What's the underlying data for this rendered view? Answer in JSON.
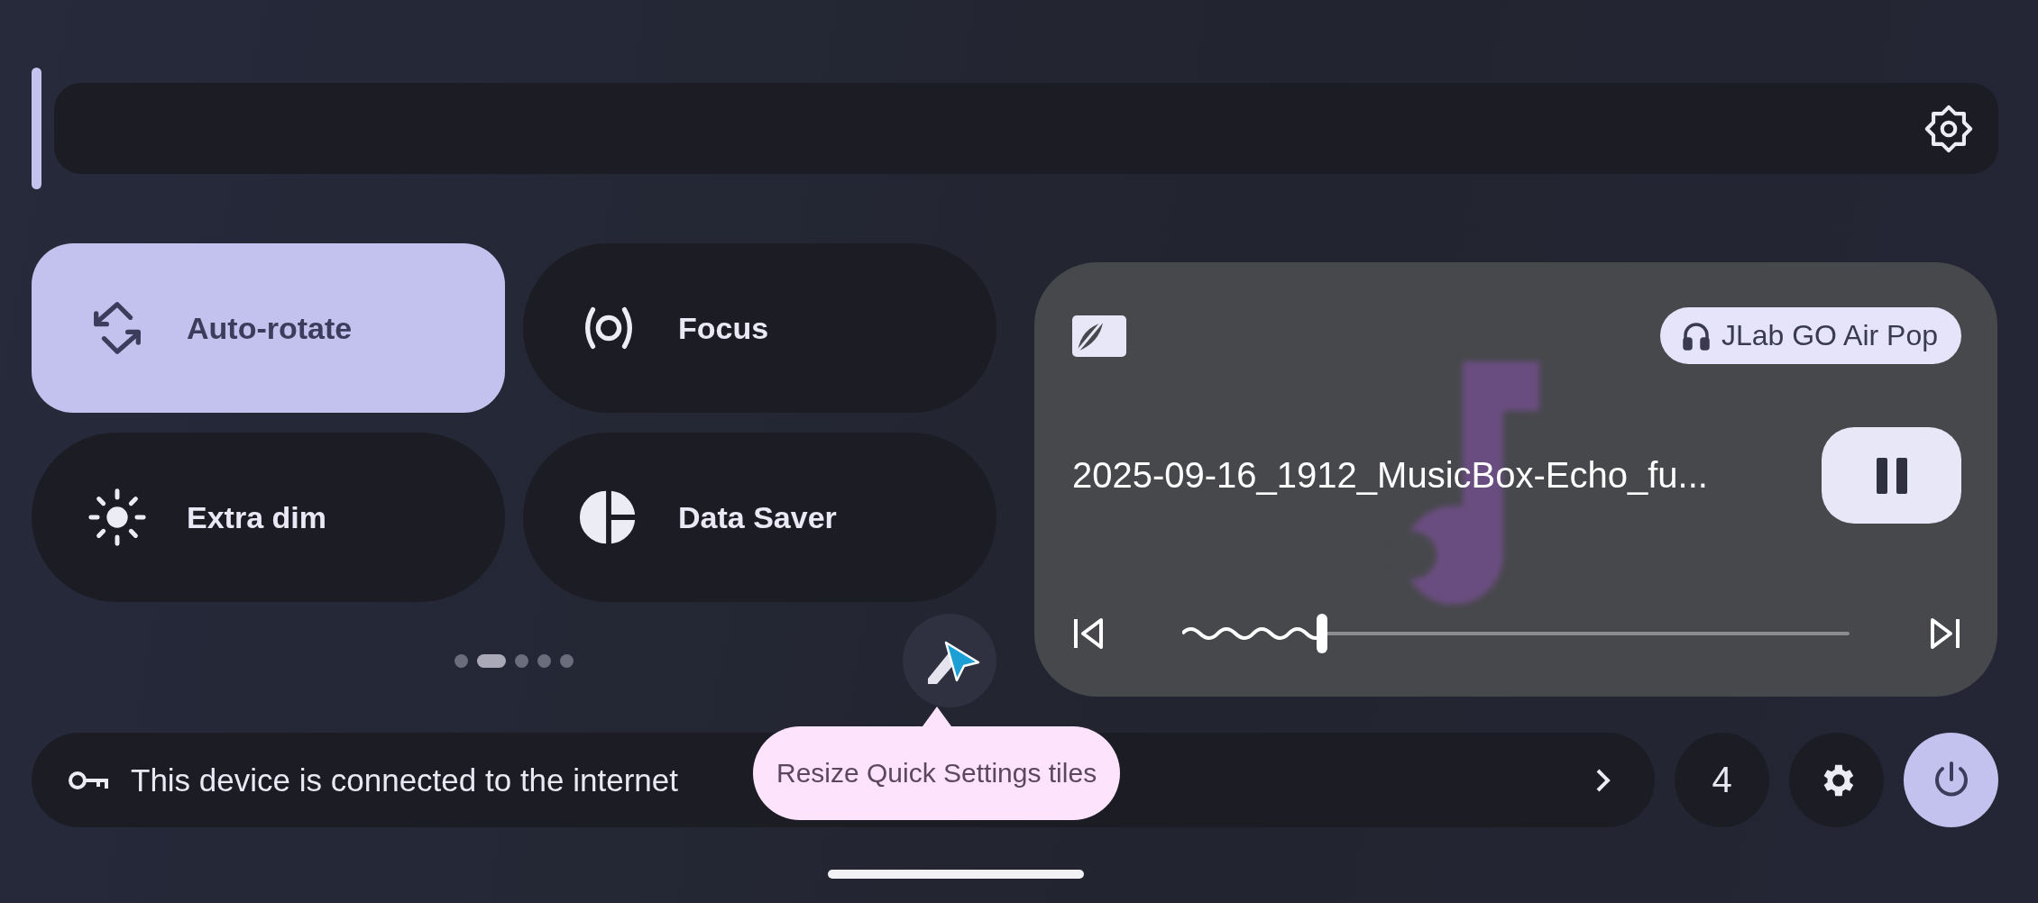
{
  "brightness": {
    "level": 0
  },
  "tiles": [
    {
      "label": "Auto-rotate",
      "kind": "rotate",
      "on": true
    },
    {
      "label": "Focus",
      "kind": "focus",
      "on": false
    },
    {
      "label": "Extra dim",
      "kind": "dim",
      "on": false
    },
    {
      "label": "Data Saver",
      "kind": "saver",
      "on": false
    }
  ],
  "pages": [
    {
      "selected": false
    },
    {
      "selected": true
    },
    {
      "selected": false
    },
    {
      "selected": false
    },
    {
      "selected": false
    }
  ],
  "media": {
    "output": "JLab GO Air Pop",
    "title": "2025-09-16_1912_MusicBox-Echo_fu...",
    "playing": true,
    "level": 0.21
  },
  "footer": {
    "security": "This device is connected to the internet",
    "user_count": "4"
  },
  "tooltip": "Resize Quick Settings tiles"
}
